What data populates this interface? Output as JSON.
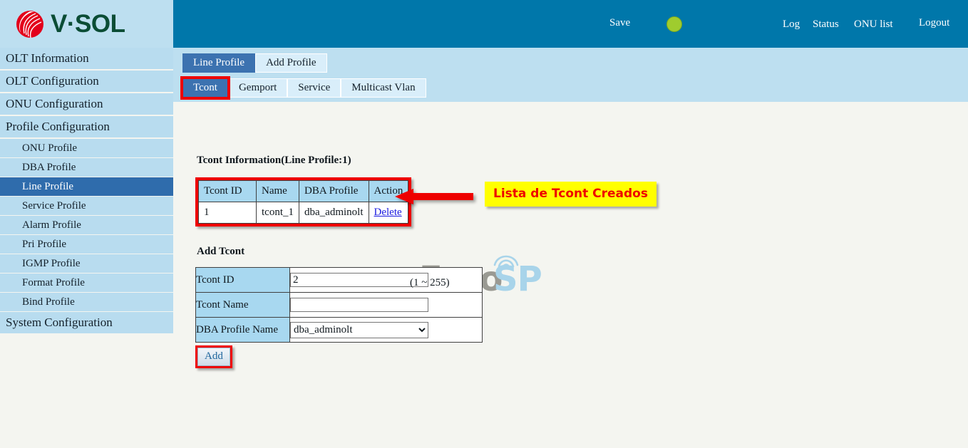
{
  "brand": {
    "logo_text": "V·SOL",
    "logo_icon": "vsol-swirl-logo"
  },
  "header": {
    "save_label": "Save",
    "status_indicator_color": "#9fcc2e",
    "links": [
      {
        "label": "Log"
      },
      {
        "label": "Status"
      },
      {
        "label": "ONU list"
      },
      {
        "label": "Logout"
      }
    ]
  },
  "sidebar": {
    "items": [
      {
        "label": "OLT Information",
        "level": "top",
        "active": false
      },
      {
        "label": "OLT Configuration",
        "level": "top",
        "active": false
      },
      {
        "label": "ONU Configuration",
        "level": "top",
        "active": false
      },
      {
        "label": "Profile Configuration",
        "level": "top",
        "active": false
      },
      {
        "label": "ONU Profile",
        "level": "sub",
        "active": false
      },
      {
        "label": "DBA Profile",
        "level": "sub",
        "active": false
      },
      {
        "label": "Line Profile",
        "level": "sub",
        "active": true
      },
      {
        "label": "Service Profile",
        "level": "sub",
        "active": false
      },
      {
        "label": "Alarm Profile",
        "level": "sub",
        "active": false
      },
      {
        "label": "Pri Profile",
        "level": "sub",
        "active": false
      },
      {
        "label": "IGMP Profile",
        "level": "sub",
        "active": false
      },
      {
        "label": "Format Profile",
        "level": "sub",
        "active": false
      },
      {
        "label": "Bind Profile",
        "level": "sub",
        "active": false
      },
      {
        "label": "System Configuration",
        "level": "top",
        "active": false
      }
    ]
  },
  "tabs": {
    "primary": [
      {
        "label": "Line Profile",
        "selected": true
      },
      {
        "label": "Add Profile",
        "selected": false
      }
    ],
    "secondary": [
      {
        "label": "Tcont",
        "selected": true,
        "highlighted": true
      },
      {
        "label": "Gemport",
        "selected": false,
        "highlighted": false
      },
      {
        "label": "Service",
        "selected": false,
        "highlighted": false
      },
      {
        "label": "Multicast Vlan",
        "selected": false,
        "highlighted": false
      }
    ]
  },
  "main": {
    "info_title": "Tcont Information(Line Profile:1)",
    "info_table": {
      "columns": [
        "Tcont ID",
        "Name",
        "DBA Profile",
        "Action"
      ],
      "rows": [
        {
          "tcont_id": "1",
          "name": "tcont_1",
          "dba_profile": "dba_adminolt",
          "action": "Delete"
        }
      ]
    },
    "add_title": "Add Tcont",
    "form": {
      "tcont_id_label": "Tcont ID",
      "tcont_id_value": "2",
      "tcont_id_hint": "(1 ~ 255)",
      "tcont_name_label": "Tcont Name",
      "tcont_name_value": "",
      "tcont_name_placeholder": "",
      "dba_profile_label": "DBA Profile Name",
      "dba_profile_value": "dba_adminolt",
      "dba_profile_options": [
        "dba_adminolt"
      ],
      "add_button": "Add"
    }
  },
  "annotation": {
    "text": "Lista de Tcont Creados",
    "label_bg": "#ffff00",
    "text_color": "#ee0000",
    "arrow_color": "#ee0000",
    "highlight_color": "#ee0000"
  },
  "watermark": {
    "part1": "Foro",
    "part2": "SP",
    "part1_color": "#9a9a93",
    "part2_color": "#a8d4ea"
  }
}
